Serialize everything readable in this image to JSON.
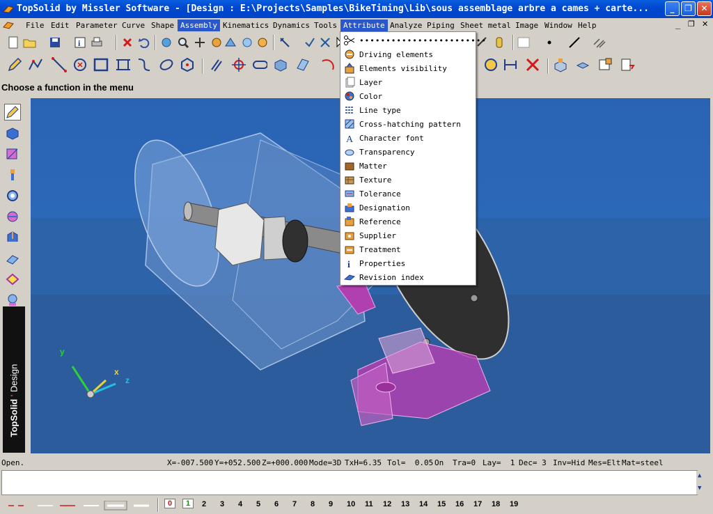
{
  "window": {
    "title": "TopSolid by Missler Software - [Design : E:\\Projects\\Samples\\BikeTiming\\Lib\\sous assemblage arbre a cames + carte..."
  },
  "menubar": {
    "items": [
      "File",
      "Edit",
      "Parameter",
      "Curve",
      "Shape",
      "Assembly",
      "Kinematics",
      "Dynamics",
      "Tools",
      "Attribute",
      "Analyze",
      "Piping",
      "Sheet metal",
      "Image",
      "Window",
      "Help"
    ],
    "active": "Assembly",
    "open": "Attribute"
  },
  "prompt": {
    "text": "Choose a function in the menu"
  },
  "attribute_menu": {
    "items": [
      {
        "label": "Driving elements",
        "icon": "driving-elements-icon"
      },
      {
        "label": "Elements visibility",
        "icon": "visibility-icon"
      },
      {
        "label": "Layer",
        "icon": "layer-icon"
      },
      {
        "label": "Color",
        "icon": "color-icon"
      },
      {
        "label": "Line type",
        "icon": "line-type-icon"
      },
      {
        "label": "Cross-hatching pattern",
        "icon": "cross-hatching-icon"
      },
      {
        "label": "Character font",
        "icon": "character-font-icon"
      },
      {
        "label": "Transparency",
        "icon": "transparency-icon"
      },
      {
        "label": "Matter",
        "icon": "matter-icon"
      },
      {
        "label": "Texture",
        "icon": "texture-icon"
      },
      {
        "label": "Tolerance",
        "icon": "tolerance-icon"
      },
      {
        "label": "Designation",
        "icon": "designation-icon"
      },
      {
        "label": "Reference",
        "icon": "reference-icon"
      },
      {
        "label": "Supplier",
        "icon": "supplier-icon"
      },
      {
        "label": "Treatment",
        "icon": "treatment-icon"
      },
      {
        "label": "Properties",
        "icon": "properties-icon"
      },
      {
        "label": "Revision index",
        "icon": "revision-index-icon"
      }
    ]
  },
  "statusbar": {
    "state": "Open.",
    "x": "X=-007.500",
    "y": "Y=+052.500",
    "z": "Z=+000.000",
    "mode": "Mode=3D",
    "txh": "TxH=6.35",
    "tol": "Tol=  0.05",
    "on": "On",
    "tra": "Tra=0",
    "lay": "Lay=  1",
    "dec": "Dec= 3",
    "inv": "Inv=Hid",
    "mes": "Mes=Elt",
    "mat": "Mat=steel"
  },
  "brand": {
    "name": "TopSolid",
    "module": "Design"
  },
  "axes": {
    "x": "x",
    "y": "y",
    "z": "z"
  },
  "layers": {
    "numbers": [
      "0",
      "1",
      "2",
      "3",
      "4",
      "5",
      "6",
      "7",
      "8",
      "9",
      "10",
      "11",
      "12",
      "13",
      "14",
      "15",
      "16",
      "17",
      "18",
      "19"
    ],
    "current": "1"
  },
  "colors": {
    "title_bar": "#0048d0",
    "menu_highlight": "#2a57c9",
    "viewport_bg": "#2b65b4",
    "part_magenta": "#b040b0"
  }
}
